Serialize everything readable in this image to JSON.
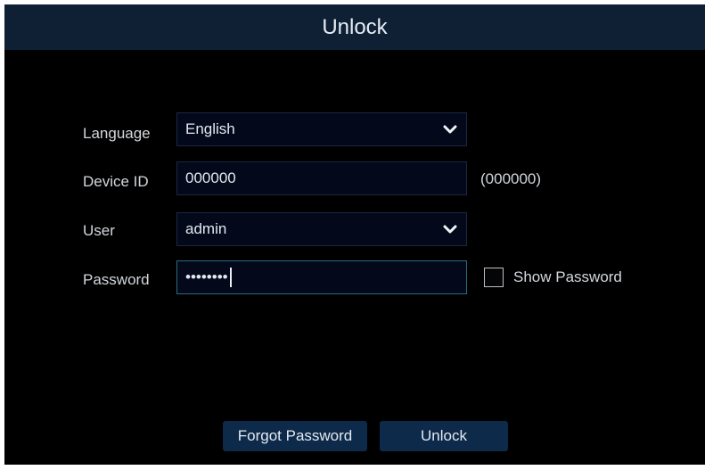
{
  "dialog": {
    "title": "Unlock"
  },
  "form": {
    "language": {
      "label": "Language",
      "value": "English"
    },
    "device_id": {
      "label": "Device ID",
      "value": "000000",
      "hint": "(000000)"
    },
    "user": {
      "label": "User",
      "value": "admin"
    },
    "password": {
      "label": "Password",
      "value": "••••••••"
    },
    "show_password": {
      "label": "Show Password",
      "checked": false
    }
  },
  "buttons": {
    "forgot_password": "Forgot Password",
    "unlock": "Unlock"
  },
  "colors": {
    "title_bar": "#0f2035",
    "background": "#000000",
    "input_bg": "#03091a",
    "focus_border": "#2b6a78",
    "button_bg": "#0d2a4a"
  },
  "icons": {
    "dropdown": "chevron-down-icon"
  }
}
